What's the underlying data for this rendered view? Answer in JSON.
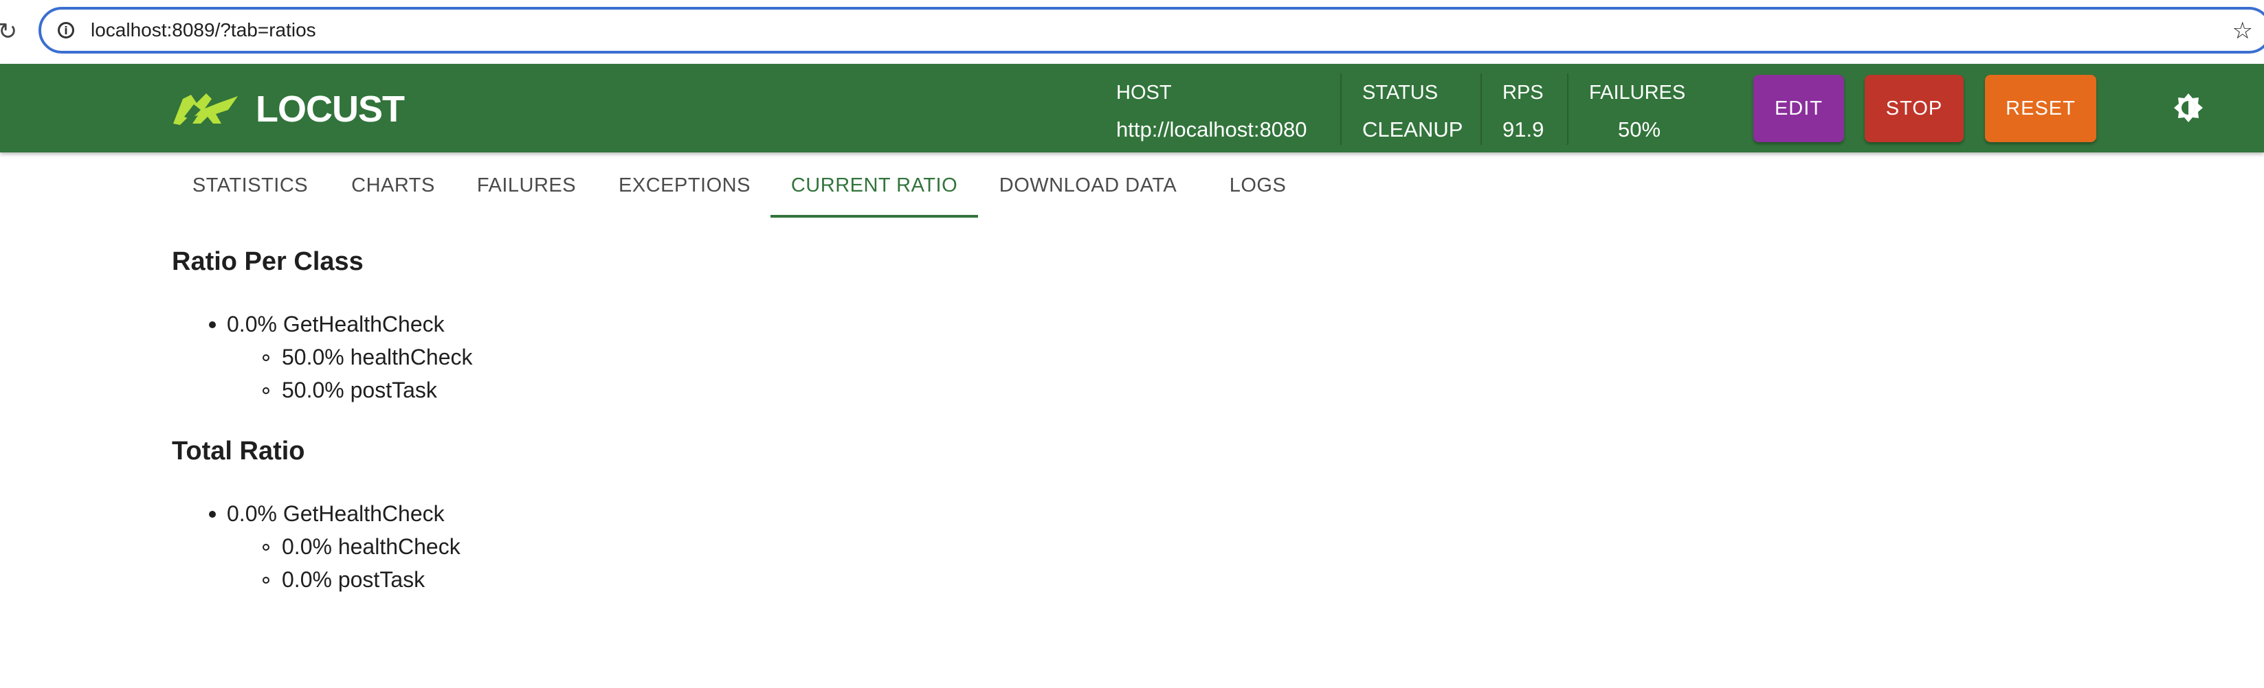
{
  "browser": {
    "url": "localhost:8089/?tab=ratios"
  },
  "header": {
    "logo_text": "LOCUST",
    "stats": {
      "host": {
        "label": "HOST",
        "value": "http://localhost:8080"
      },
      "status": {
        "label": "STATUS",
        "value": "CLEANUP"
      },
      "rps": {
        "label": "RPS",
        "value": "91.9"
      },
      "failures": {
        "label": "FAILURES",
        "value": "50%"
      }
    },
    "buttons": {
      "edit": "EDIT",
      "stop": "STOP",
      "reset": "RESET"
    },
    "colors": {
      "header_bg": "#32743b",
      "edit_bg": "#8b2f9c",
      "stop_bg": "#c0352a",
      "reset_bg": "#e56a1c",
      "logo_accent": "#b6e03c"
    }
  },
  "tabs": [
    {
      "label": "STATISTICS",
      "active": false
    },
    {
      "label": "CHARTS",
      "active": false
    },
    {
      "label": "FAILURES",
      "active": false
    },
    {
      "label": "EXCEPTIONS",
      "active": false
    },
    {
      "label": "CURRENT RATIO",
      "active": true
    },
    {
      "label": "DOWNLOAD DATA",
      "active": false
    },
    {
      "label": "LOGS",
      "active": false
    }
  ],
  "ratio_per_class": {
    "title": "Ratio Per Class",
    "classes": [
      {
        "label": "0.0% GetHealthCheck",
        "tasks": [
          "50.0% healthCheck",
          "50.0% postTask"
        ]
      }
    ]
  },
  "total_ratio": {
    "title": "Total Ratio",
    "classes": [
      {
        "label": "0.0% GetHealthCheck",
        "tasks": [
          "0.0% healthCheck",
          "0.0% postTask"
        ]
      }
    ]
  },
  "icons": {
    "reload": "reload-icon",
    "info": "info-icon",
    "star": "star-icon",
    "theme": "theme-toggle-icon"
  }
}
